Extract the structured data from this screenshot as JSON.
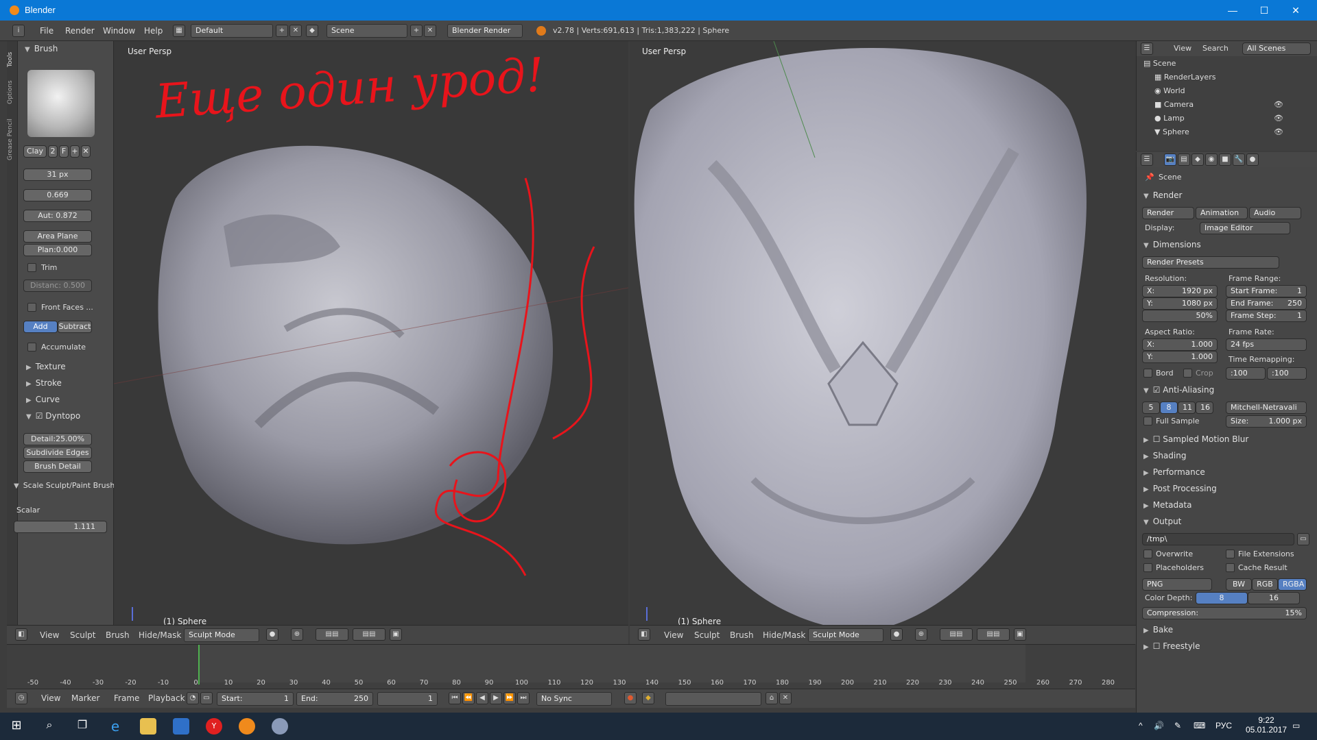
{
  "window": {
    "title": "Blender",
    "minimize": "—",
    "maximize": "☐",
    "close": "✕"
  },
  "info_header": {
    "menus": [
      "File",
      "Render",
      "Window",
      "Help"
    ],
    "layout": "Default",
    "scene": "Scene",
    "engine": "Blender Render",
    "stats": "v2.78 | Verts:691,613 | Tris:1,383,222 | Sphere"
  },
  "tool_tabs": [
    "Tools",
    "Options",
    "Grease Pencil"
  ],
  "toolshelf": {
    "brush_header": "Brush",
    "brush_name": "Clay",
    "brush_users": "2",
    "brush_fake": "F",
    "radius": "31 px",
    "strength": "0.669",
    "autosmooth": "Aut: 0.872",
    "sculpt_plane": "Area Plane",
    "plane_offset": "Plan:0.000",
    "trim": "Trim",
    "distance": "Distanc: 0.500",
    "front_faces": "Front Faces ...",
    "add": "Add",
    "subtract": "Subtract",
    "accumulate": "Accumulate",
    "texture": "Texture",
    "stroke": "Stroke",
    "curve": "Curve",
    "dyntopo": "Dyntopo",
    "detail": "Detail:25.00%",
    "subdivide": "Subdivide Edges",
    "brush_detail": "Brush Detail",
    "operator": "Scale Sculpt/Paint Brush",
    "scalar_label": "Scalar",
    "scalar_value": "1.111"
  },
  "viewport_left": {
    "label": "User Persp",
    "object": "(1) Sphere"
  },
  "viewport_right": {
    "label": "User Persp",
    "object": "(1) Sphere"
  },
  "annotation_text": "Еще один урод!",
  "view_header": {
    "menus": [
      "View",
      "Sculpt",
      "Brush",
      "Hide/Mask"
    ],
    "mode": "Sculpt Mode"
  },
  "timeline": {
    "ticks": [
      "-50",
      "-40",
      "-30",
      "-20",
      "-10",
      "0",
      "10",
      "20",
      "30",
      "40",
      "50",
      "60",
      "70",
      "80",
      "90",
      "100",
      "110",
      "120",
      "130",
      "140",
      "150",
      "160",
      "170",
      "180",
      "190",
      "200",
      "210",
      "220",
      "230",
      "240",
      "250",
      "260",
      "270",
      "280"
    ],
    "menus": [
      "View",
      "Marker",
      "Frame",
      "Playback"
    ],
    "start": "Start:",
    "start_val": "1",
    "end": "End:",
    "end_val": "250",
    "current": "1",
    "sync": "No Sync"
  },
  "outliner": {
    "view": "View",
    "search": "Search",
    "filter": "All Scenes",
    "items": [
      "Scene",
      "RenderLayers",
      "World",
      "Camera",
      "Lamp",
      "Sphere"
    ]
  },
  "properties": {
    "context": "Scene",
    "render": "Render",
    "render_btn": "Render",
    "animation_btn": "Animation",
    "audio_btn": "Audio",
    "display_label": "Display:",
    "display_val": "Image Editor",
    "dimensions": "Dimensions",
    "presets": "Render Presets",
    "resolution": "Resolution:",
    "res_x": "X:",
    "res_x_val": "1920 px",
    "res_y": "Y:",
    "res_y_val": "1080 px",
    "res_pct": "50%",
    "frame_range": "Frame Range:",
    "start_frame": "Start Frame:",
    "start_frame_val": "1",
    "end_frame": "End Frame:",
    "end_frame_val": "250",
    "frame_step": "Frame Step:",
    "frame_step_val": "1",
    "aspect": "Aspect Ratio:",
    "asp_x": "X:",
    "asp_x_val": "1.000",
    "asp_y": "Y:",
    "asp_y_val": "1.000",
    "frame_rate": "Frame Rate:",
    "fps": "24 fps",
    "time_remap": "Time Remapping:",
    "remap_old": ":100",
    "remap_new": ":100",
    "bord": "Bord",
    "crop": "Crop",
    "aa": "Anti-Aliasing",
    "aa_samples": [
      "5",
      "8",
      "11",
      "16"
    ],
    "aa_filter": "Mitchell-Netravali",
    "full_sample": "Full Sample",
    "size": "Size:",
    "size_val": "1.000 px",
    "motion_blur": "Sampled Motion Blur",
    "shading": "Shading",
    "performance": "Performance",
    "post": "Post Processing",
    "metadata": "Metadata",
    "output": "Output",
    "path": "/tmp\\",
    "overwrite": "Overwrite",
    "file_ext": "File Extensions",
    "placeholders": "Placeholders",
    "cache": "Cache Result",
    "format": "PNG",
    "bw": "BW",
    "rgb": "RGB",
    "rgba": "RGBA",
    "color_depth": "Color Depth:",
    "depth8": "8",
    "depth16": "16",
    "compression": "Compression:",
    "compression_val": "15%",
    "bake": "Bake",
    "freestyle": "Freestyle"
  },
  "taskbar": {
    "lang": "РУС",
    "time": "9:22",
    "date": "05.01.2017"
  },
  "colors": {
    "accent": "#5680c2",
    "annotation": "#e8141b",
    "titlebar": "#0a78d6"
  }
}
